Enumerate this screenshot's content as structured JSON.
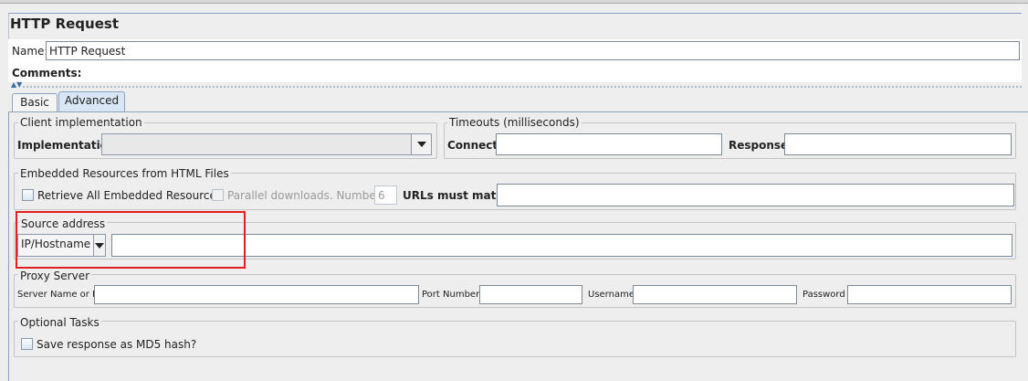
{
  "header": {
    "title": "HTTP Request",
    "name_label": "Name:",
    "name_value": "HTTP Request",
    "comments_label": "Comments:",
    "comments_value": ""
  },
  "tabs": [
    {
      "label": "Basic",
      "active": false
    },
    {
      "label": "Advanced",
      "active": true
    }
  ],
  "client_implementation": {
    "title": "Client implementation",
    "implementation_label": "Implementation:",
    "implementation_value": ""
  },
  "timeouts": {
    "title": "Timeouts (milliseconds)",
    "connect_label": "Connect:",
    "connect_value": "",
    "response_label": "Response:",
    "response_value": ""
  },
  "embedded": {
    "title": "Embedded Resources from HTML Files",
    "retrieve_label": "Retrieve All Embedded Resources",
    "retrieve_checked": false,
    "parallel_label": "Parallel downloads. Number:",
    "parallel_checked": false,
    "parallel_number": "6",
    "urls_label": "URLs must match:",
    "urls_value": ""
  },
  "source_address": {
    "title": "Source address",
    "type_value": "IP/Hostname",
    "address_value": ""
  },
  "proxy": {
    "title": "Proxy Server",
    "server_label": "Server Name or IP:",
    "server_value": "",
    "port_label": "Port Number:",
    "port_value": "",
    "username_label": "Username",
    "username_value": "",
    "password_label": "Password",
    "password_value": ""
  },
  "optional_tasks": {
    "title": "Optional Tasks",
    "md5_label": "Save response as MD5 hash?",
    "md5_checked": false
  },
  "icons": {
    "collapse_arrows": "▲▼"
  },
  "colors": {
    "highlight": "#e02020",
    "tab_active": "#d9e6f5",
    "border_accent": "#8da2bd"
  }
}
